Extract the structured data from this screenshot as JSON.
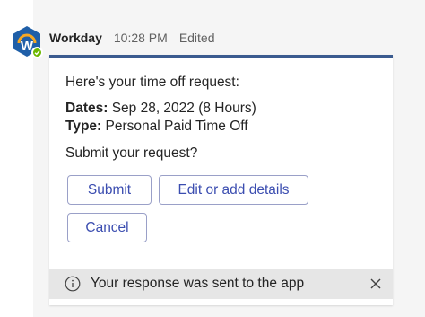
{
  "message": {
    "sender": "Workday",
    "time": "10:28 PM",
    "status": "Edited",
    "avatar_icon": "workday-logo-icon",
    "presence_icon": "available-check-icon",
    "accent_color": "#3b5b8f"
  },
  "card": {
    "intro": "Here's your time off request:",
    "dates_label": "Dates:",
    "dates_value": " Sep 28, 2022 (8 Hours)",
    "type_label": "Type:",
    "type_value": " Personal Paid Time Off",
    "prompt": "Submit your request?",
    "buttons": {
      "submit": "Submit",
      "edit": "Edit or add details",
      "cancel": "Cancel"
    }
  },
  "notice": {
    "text": "Your response was sent to the app",
    "info_icon": "info-icon",
    "close_icon": "close-icon"
  }
}
